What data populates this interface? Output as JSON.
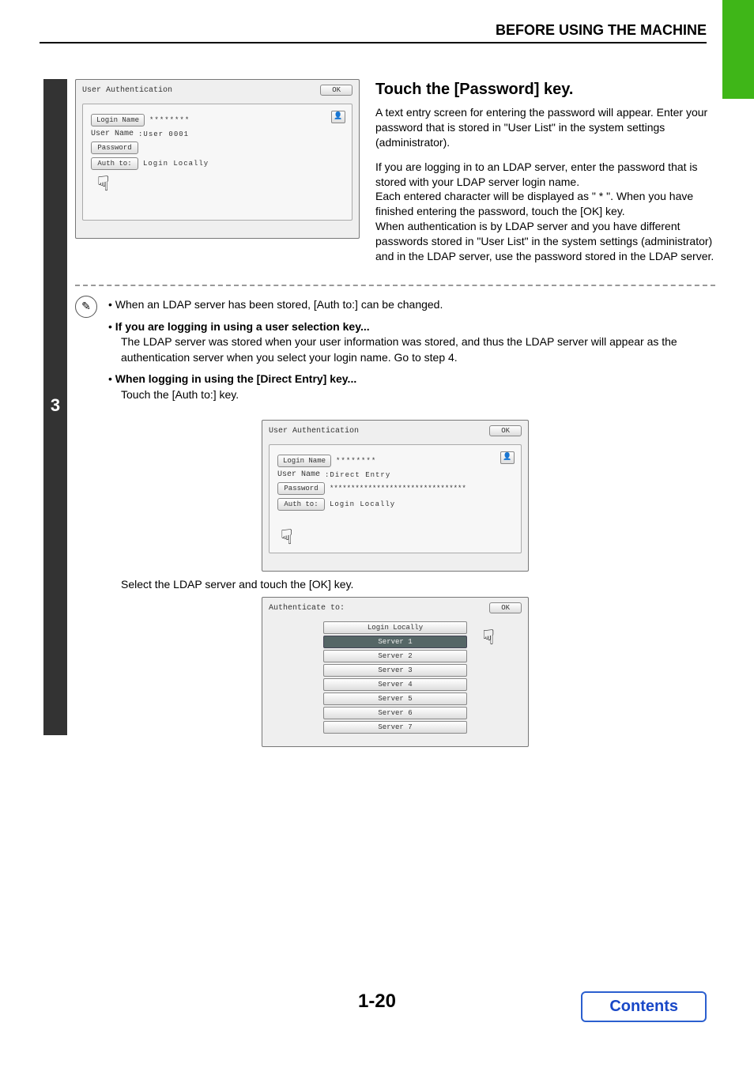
{
  "header": "BEFORE USING THE MACHINE",
  "step_number": "3",
  "dialog1": {
    "title": "User Authentication",
    "ok": "OK",
    "login_name_btn": "Login Name",
    "login_name_val": "********",
    "user_name_lbl": "User Name",
    "user_name_val": ":User 0001",
    "password_btn": "Password",
    "auth_to_btn": "Auth to:",
    "auth_to_val": "Login Locally"
  },
  "right": {
    "heading": "Touch the [Password] key.",
    "p1": "A text entry screen for entering the password will appear. Enter your password that is stored in \"User List\" in the system settings (administrator).",
    "p2": "If you are logging in to an LDAP server, enter the password that is stored with your LDAP server login name.",
    "p3": "Each entered character will be displayed as \" * \". When you have finished entering the password, touch the [OK] key.",
    "p4": "When authentication is by LDAP server and you have different passwords stored in \"User List\" in the system settings (administrator) and in the LDAP server, use the password stored in the LDAP server."
  },
  "note": "When an LDAP server has been stored, [Auth to:] can be changed.",
  "bullets": {
    "b1_title": "If you are logging in using a user selection key...",
    "b1_body": "The LDAP server was stored when your user information was stored, and thus the LDAP server will appear as the authentication server when you select your login name. Go to step 4.",
    "b2_title": "When logging in using the [Direct Entry] key...",
    "b2_body": "Touch the [Auth to:] key."
  },
  "dialog2": {
    "title": "User Authentication",
    "ok": "OK",
    "login_name_btn": "Login Name",
    "login_name_val": "********",
    "user_name_lbl": "User Name",
    "user_name_val": ":Direct Entry",
    "password_btn": "Password",
    "password_val": "********************************",
    "auth_to_btn": "Auth to:",
    "auth_to_val": "Login Locally"
  },
  "after_dialog2": "Select the LDAP server and touch the [OK] key.",
  "dialog3": {
    "title": "Authenticate to:",
    "ok": "OK",
    "servers": [
      "Login Locally",
      "Server 1",
      "Server 2",
      "Server 3",
      "Server 4",
      "Server 5",
      "Server 6",
      "Server 7"
    ],
    "selected_index": 1
  },
  "page_number": "1-20",
  "contents": "Contents"
}
